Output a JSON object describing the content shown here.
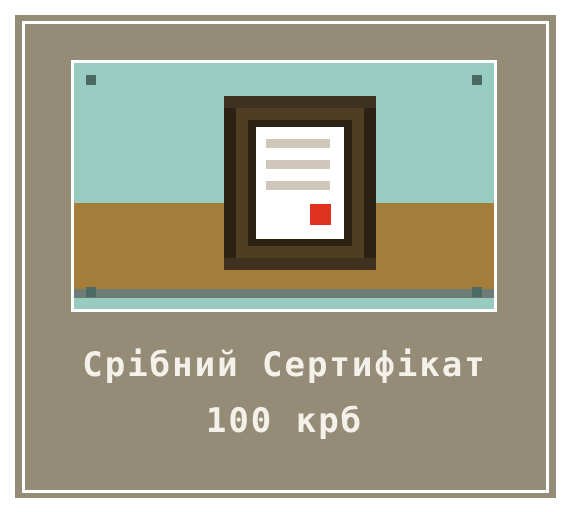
{
  "item": {
    "name": "Срібний Сертифікат",
    "price": "100 крб"
  },
  "image": {
    "icon": "framed-certificate-icon",
    "colors": {
      "wall": "#99ccc1",
      "floor": "#a47d3a",
      "frame": "#3e3120",
      "paper": "#ffffff",
      "seal": "#e0321c",
      "card_background": "#948c76"
    }
  }
}
